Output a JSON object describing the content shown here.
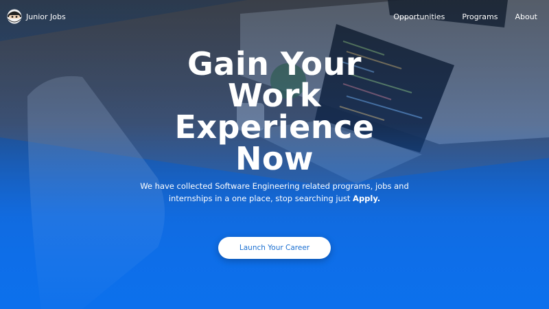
{
  "brand": {
    "name": "Junior Jobs",
    "logo_icon": "ninja-avatar-icon"
  },
  "nav": {
    "links": [
      "Opportunities",
      "Programs",
      "About"
    ]
  },
  "hero": {
    "headline": "Gain Your Work Experience Now",
    "subtitle_text": "We have collected Software Engineering related programs, jobs and internships in a one place, stop searching just ",
    "subtitle_emphasis": "Apply.",
    "cta_label": "Launch Your Career"
  },
  "colors": {
    "accent": "#1a73e8",
    "cta_text": "#1a6fd1",
    "text": "#ffffff"
  }
}
